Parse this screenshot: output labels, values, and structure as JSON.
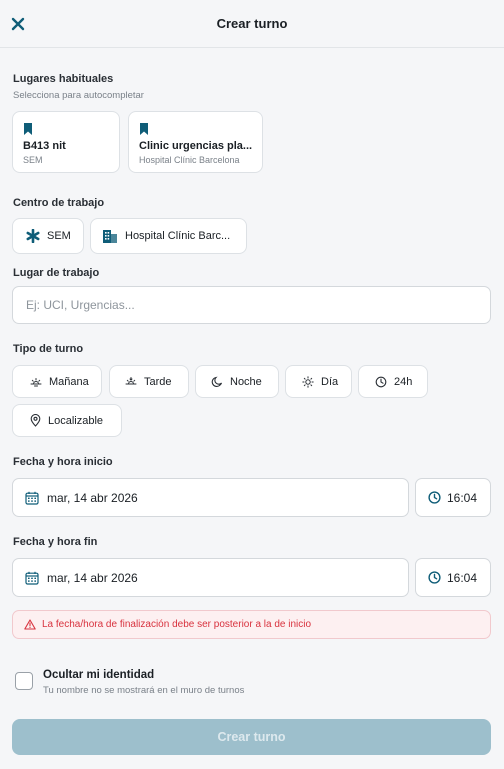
{
  "header": {
    "title": "Crear turno",
    "close_icon": "close-icon"
  },
  "colors": {
    "accent": "#0f5d78",
    "error": "#d8323e",
    "button_disabled": "#9dbfcc"
  },
  "lugares": {
    "label": "Lugares habituales",
    "sub": "Selecciona para autocompletar",
    "items": [
      {
        "title": "B413 nit",
        "sub": "SEM",
        "icon": "bookmark-icon"
      },
      {
        "title": "Clinic urgencias pla...",
        "sub": "Hospital Clínic Barcelona",
        "icon": "bookmark-icon"
      }
    ]
  },
  "centro": {
    "label": "Centro de trabajo",
    "items": [
      {
        "label": "SEM",
        "icon": "asterisk-icon"
      },
      {
        "label": "Hospital Clínic Barc...",
        "icon": "building-icon"
      }
    ]
  },
  "lugar_trabajo": {
    "label": "Lugar de trabajo",
    "placeholder": "Ej: UCI, Urgencias..."
  },
  "tipo_turno": {
    "label": "Tipo de turno",
    "options": [
      {
        "label": "Mañana",
        "icon": "sunrise-icon"
      },
      {
        "label": "Tarde",
        "icon": "sunset-icon"
      },
      {
        "label": "Noche",
        "icon": "moon-icon"
      },
      {
        "label": "Día",
        "icon": "sun-icon"
      },
      {
        "label": "24h",
        "icon": "clock-icon"
      },
      {
        "label": "Localizable",
        "icon": "location-pin-icon"
      }
    ]
  },
  "inicio": {
    "label": "Fecha y hora inicio",
    "date": "mar, 14 abr 2026",
    "time": "16:04"
  },
  "fin": {
    "label": "Fecha y hora fin",
    "date": "mar, 14 abr 2026",
    "time": "16:04"
  },
  "error": {
    "message": "La fecha/hora de finalización debe ser posterior a la de inicio",
    "icon": "warning-icon"
  },
  "identidad": {
    "title": "Ocultar mi identidad",
    "sub": "Tu nombre no se mostrará en el muro de turnos",
    "checked": false
  },
  "submit": {
    "label": "Crear turno"
  }
}
